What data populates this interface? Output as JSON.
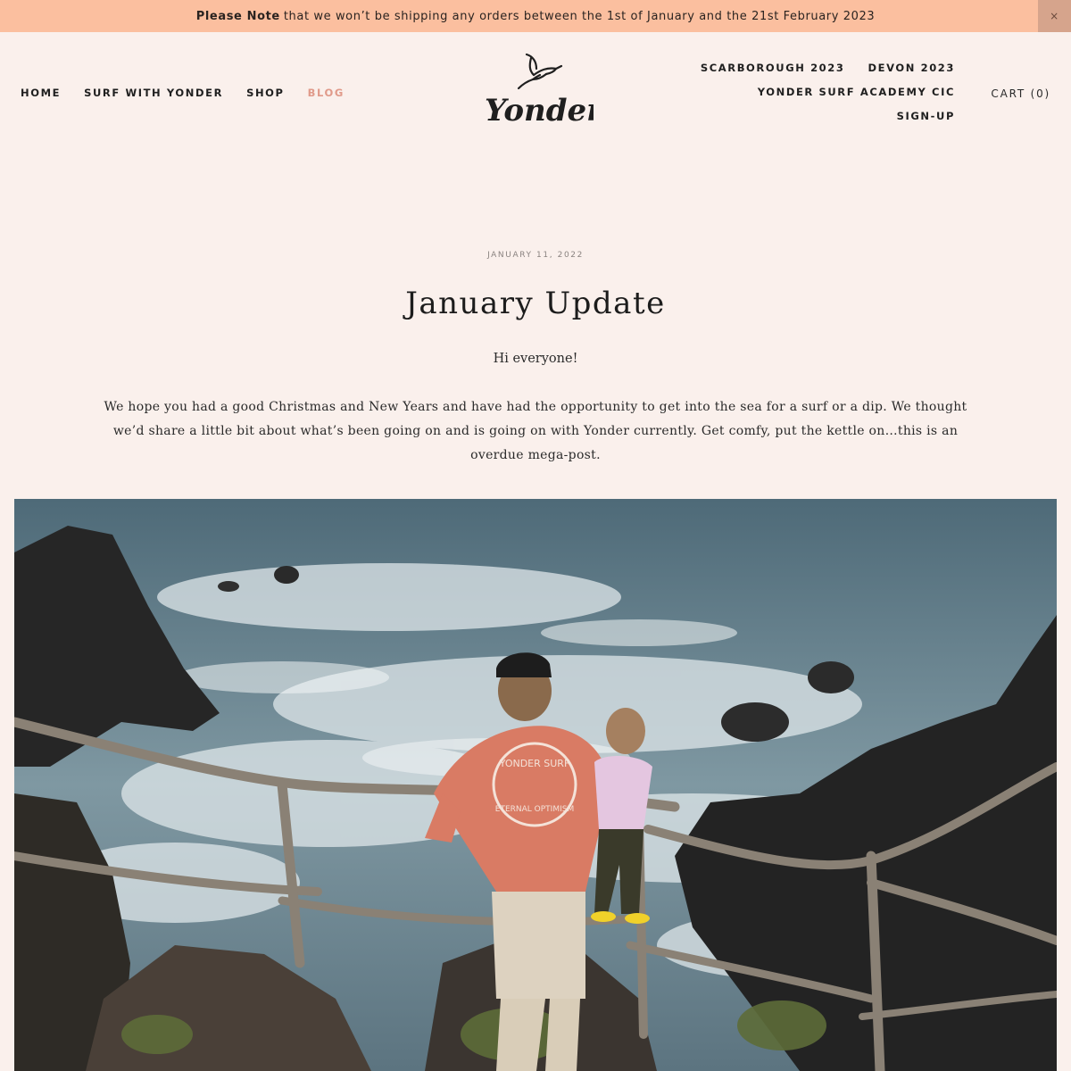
{
  "announcement": {
    "bold": "Please Note",
    "text": "that we won’t be shipping any orders between the 1st of January and the 21st February 2023",
    "close_glyph": "×"
  },
  "nav_left": [
    {
      "label": "HOME",
      "active": false
    },
    {
      "label": "SURF WITH YONDER",
      "active": false
    },
    {
      "label": "SHOP",
      "active": false
    },
    {
      "label": "BLOG",
      "active": true
    }
  ],
  "logo": {
    "text": "Yonder",
    "icon": "seabird-logo-icon"
  },
  "nav_right": {
    "row1": [
      "SCARBOROUGH 2023",
      "DEVON 2023"
    ],
    "row2": [
      "YONDER SURF ACADEMY CIC"
    ],
    "row3": [
      "SIGN-UP"
    ]
  },
  "cart": {
    "label": "CART (0)"
  },
  "article": {
    "date": "JANUARY 11, 2022",
    "title": "January Update",
    "greeting": "Hi everyone!",
    "intro": "We hope you had a good Christmas and New Years and have had the opportunity to get into the sea for a surf or a dip. We thought we’d share a little bit about what’s been going on and is going on with Yonder currently. Get comfy, put the kettle on…this is an overdue mega-post.",
    "shirt_text_1": "YONDER SURF",
    "shirt_text_2": "ETERNAL OPTIMISM"
  },
  "colors": {
    "background": "#faf0ec",
    "announcement_bar": "#fbbf9f",
    "active_link": "#e09a8a"
  }
}
